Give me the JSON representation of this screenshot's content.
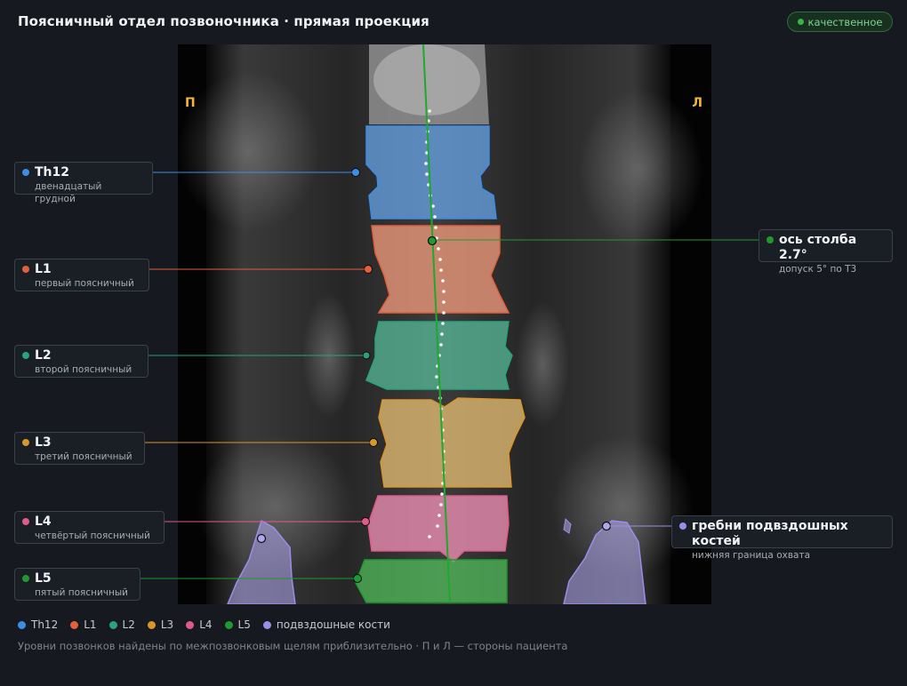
{
  "header": {
    "title": "Поясничный отдел позвоночника · прямая проекция",
    "badge": "качественное"
  },
  "image": {
    "side_right_patient": "П",
    "side_left_patient": "Л"
  },
  "vertebrae": [
    {
      "id": "th12",
      "name": "Th12",
      "sub": "двенадцатый грудной",
      "color": "#3b8de6"
    },
    {
      "id": "l1",
      "name": "L1",
      "sub": "первый поясничный",
      "color": "#e2603a"
    },
    {
      "id": "l2",
      "name": "L2",
      "sub": "второй поясничный",
      "color": "#27a37e"
    },
    {
      "id": "l3",
      "name": "L3",
      "sub": "третий поясничный",
      "color": "#d9962a"
    },
    {
      "id": "l4",
      "name": "L4",
      "sub": "четвёртый поясничный",
      "color": "#e05a8a"
    },
    {
      "id": "l5",
      "name": "L5",
      "sub": "пятый поясничный",
      "color": "#1f9a2e"
    }
  ],
  "axis": {
    "name": "ось столба 2.7°",
    "sub": "допуск 5° по Т3",
    "color": "#1f9a2e"
  },
  "iliac": {
    "name": "гребни подвздошных костей",
    "sub": "нижняя граница охвата",
    "color": "#9a8ee8"
  },
  "legend": [
    {
      "label": "Th12",
      "color": "#3b8de6"
    },
    {
      "label": "L1",
      "color": "#e2603a"
    },
    {
      "label": "L2",
      "color": "#27a37e"
    },
    {
      "label": "L3",
      "color": "#d9962a"
    },
    {
      "label": "L4",
      "color": "#e05a8a"
    },
    {
      "label": "L5",
      "color": "#1f9a2e"
    },
    {
      "label": "подвздошные кости",
      "color": "#9a8ee8"
    }
  ],
  "footnote": "Уровни позвонков найдены по межпозвонковым щелям приблизительно · П и Л — стороны пациента"
}
